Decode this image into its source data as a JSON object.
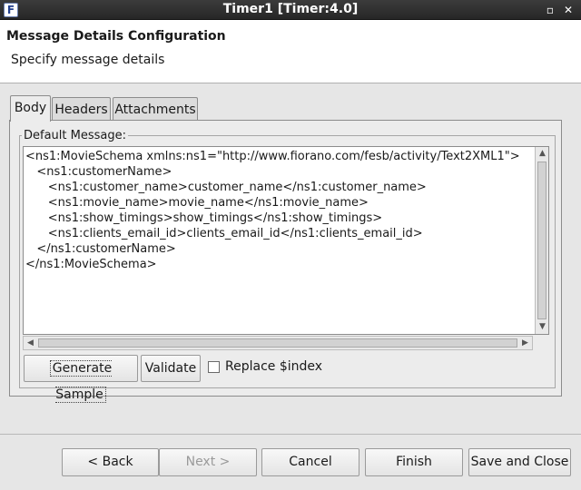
{
  "window": {
    "title": "Timer1 [Timer:4.0]",
    "icon_glyph": "F",
    "minimize_glyph": "▫",
    "close_glyph": "✕"
  },
  "header": {
    "title": "Message Details Configuration",
    "subtitle": "Specify message details"
  },
  "tabs": [
    {
      "label": "Body",
      "active": true
    },
    {
      "label": "Headers",
      "active": false
    },
    {
      "label": "Attachments",
      "active": false
    }
  ],
  "body": {
    "group_label": "Default Message:",
    "message_lines": [
      "<ns1:MovieSchema xmlns:ns1=\"http://www.fiorano.com/fesb/activity/Text2XML1\">",
      "   <ns1:customerName>",
      "      <ns1:customer_name>customer_name</ns1:customer_name>",
      "      <ns1:movie_name>movie_name</ns1:movie_name>",
      "      <ns1:show_timings>show_timings</ns1:show_timings>",
      "      <ns1:clients_email_id>clients_email_id</ns1:clients_email_id>",
      "   </ns1:customerName>",
      "</ns1:MovieSchema>"
    ],
    "generate_label": "Generate Sample",
    "validate_label": "Validate",
    "replace_label": "Replace $index",
    "replace_checked": false
  },
  "footer": {
    "back_label": "< Back",
    "next_label": "Next >",
    "cancel_label": "Cancel",
    "finish_label": "Finish",
    "save_close_label": "Save and Close"
  },
  "icons": {
    "app": "fiorano-app-icon",
    "minimize": "minimize-icon",
    "close": "close-icon",
    "scroll_up": "arrow-up-icon",
    "scroll_down": "arrow-down-icon",
    "scroll_left": "arrow-left-icon",
    "scroll_right": "arrow-right-icon"
  },
  "colors": {
    "titlebar": "#2f2f2f",
    "header_bg": "#ffffff",
    "panel_bg": "#ececec",
    "window_bg": "#e6e6e6"
  }
}
